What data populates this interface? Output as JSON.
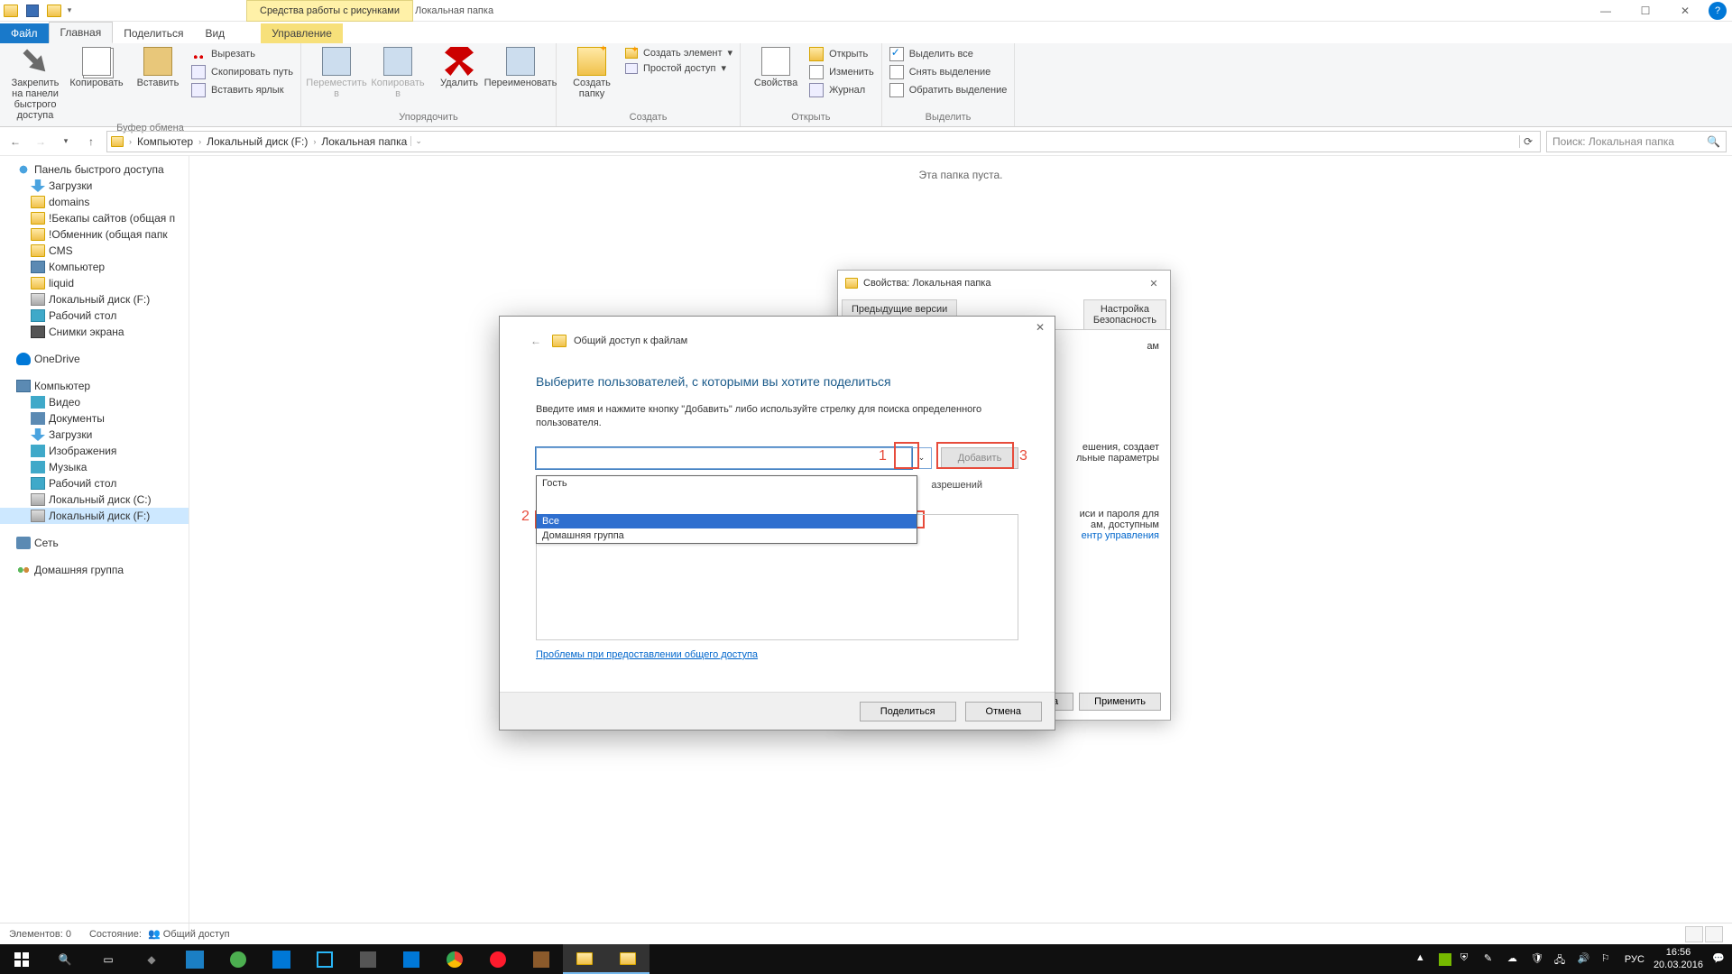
{
  "window": {
    "context_tab": "Средства работы с рисунками",
    "title": "Локальная папка",
    "minimize": "—",
    "maximize": "☐",
    "close": "✕",
    "help": "?"
  },
  "tabs": {
    "file": "Файл",
    "home": "Главная",
    "share": "Поделиться",
    "view": "Вид",
    "manage": "Управление"
  },
  "ribbon": {
    "pin": "Закрепить на панели быстрого доступа",
    "copy": "Копировать",
    "paste": "Вставить",
    "cut": "Вырезать",
    "copypath": "Скопировать путь",
    "pastelink": "Вставить ярлык",
    "g_clipboard": "Буфер обмена",
    "moveto": "Переместить в",
    "copyto": "Копировать в",
    "delete": "Удалить",
    "rename": "Переименовать",
    "g_organize": "Упорядочить",
    "newfolder": "Создать папку",
    "newitem": "Создать элемент",
    "easyaccess": "Простой доступ",
    "g_new": "Создать",
    "properties": "Свойства",
    "open": "Открыть",
    "edit": "Изменить",
    "history": "Журнал",
    "g_open": "Открыть",
    "selectall": "Выделить все",
    "selectnone": "Снять выделение",
    "invert": "Обратить выделение",
    "g_select": "Выделить"
  },
  "address": {
    "back": "←",
    "fwd": "→",
    "up": "↑",
    "crumbs": [
      "Компьютер",
      "Локальный диск (F:)",
      "Локальная папка"
    ],
    "refresh": "⟳",
    "search_ph": "Поиск: Локальная папка"
  },
  "tree": {
    "quick": "Панель быстрого доступа",
    "quick_items": [
      "Загрузки",
      "domains",
      "!Бекапы сайтов (общая п",
      "!Обменник (общая папк",
      "CMS",
      "Компьютер",
      "liquid",
      "Локальный диск (F:)",
      "Рабочий стол",
      "Снимки экрана"
    ],
    "onedrive": "OneDrive",
    "computer": "Компьютер",
    "comp_items": [
      "Видео",
      "Документы",
      "Загрузки",
      "Изображения",
      "Музыка",
      "Рабочий стол",
      "Локальный диск (C:)",
      "Локальный диск (F:)"
    ],
    "network": "Сеть",
    "homegroup": "Домашняя группа"
  },
  "content": {
    "empty": "Эта папка пуста."
  },
  "status": {
    "items": "Элементов: 0",
    "state_label": "Состояние:",
    "state_value": "Общий доступ"
  },
  "props": {
    "title": "Свойства: Локальная папка",
    "tab_prev": "Предыдущие версии",
    "tab_cfg": "Настройка",
    "tab_sec": "Безопасность",
    "text1": "ам",
    "text2_a": "ешения, создает",
    "text2_b": "льные параметры",
    "text3_a": "иси и пароля для",
    "text3_b": "ам, доступным",
    "link": "ентр управления",
    "btn_cancel": "ена",
    "btn_apply": "Применить"
  },
  "share": {
    "title": "Общий доступ к файлам",
    "heading": "Выберите пользователей, с которыми вы хотите поделиться",
    "desc": "Введите имя и нажмите кнопку \"Добавить\" либо используйте стрелку для поиска определенного пользователя.",
    "add": "Добавить",
    "options": [
      "Гость",
      "Все",
      "Домашняя группа"
    ],
    "perm_col": "азрешений",
    "help": "Проблемы при предоставлении общего доступа",
    "btn_share": "Поделиться",
    "btn_cancel": "Отмена",
    "annot1": "1",
    "annot2": "2",
    "annot3": "3"
  },
  "taskbar": {
    "lang": "РУС",
    "time": "16:56",
    "date": "20.03.2016"
  }
}
